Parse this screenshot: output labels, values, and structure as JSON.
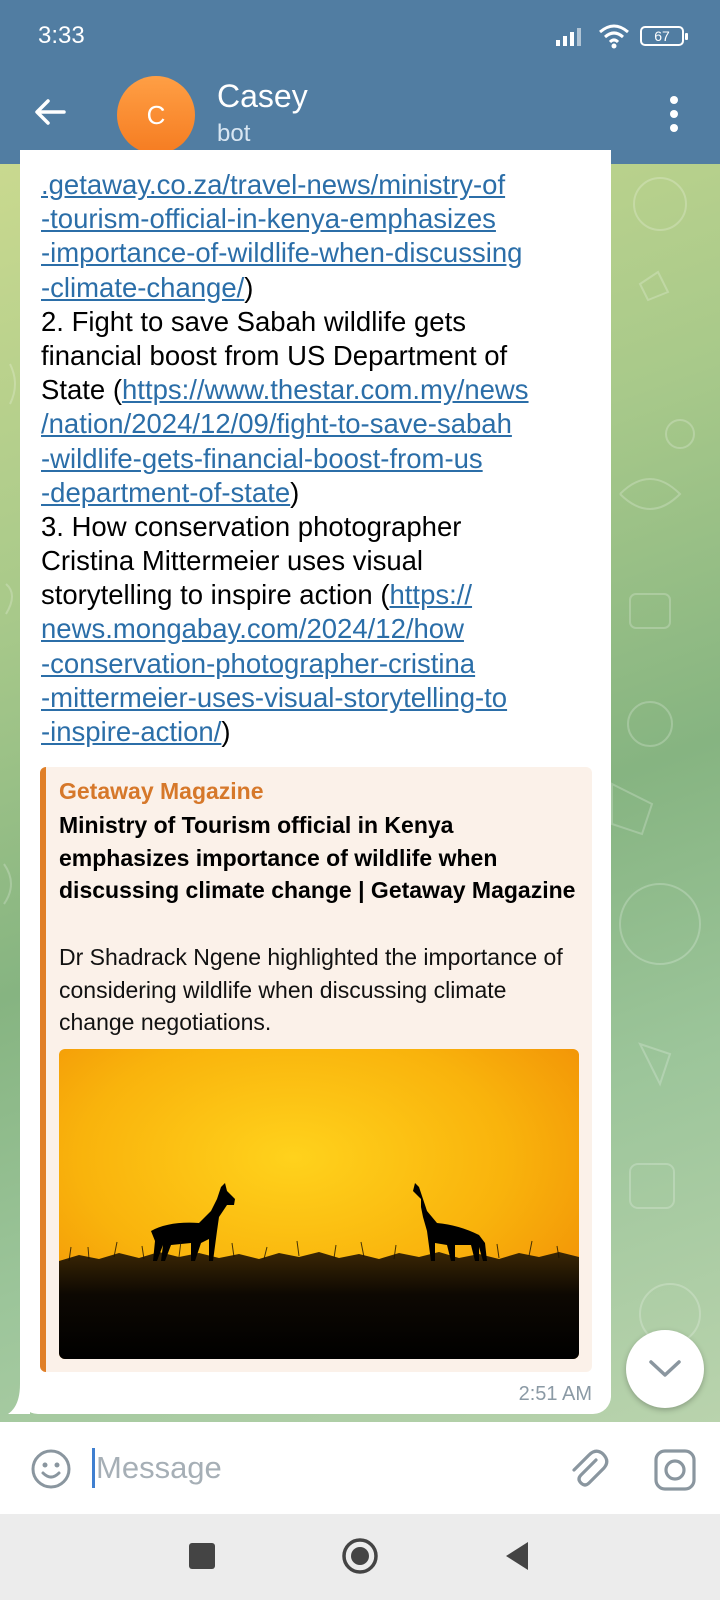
{
  "status_bar": {
    "time": "3:33",
    "battery": "67"
  },
  "header": {
    "avatar_letter": "C",
    "name": "Casey",
    "subtitle": "bot"
  },
  "message": {
    "lines": [
      [
        {
          "t": ".getaway.co.za/travel-news/ministry-of",
          "link": true
        }
      ],
      [
        {
          "t": "-tourism-official-in-kenya-emphasizes",
          "link": true
        }
      ],
      [
        {
          "t": "-importance-of-wildlife-when-discussing",
          "link": true
        }
      ],
      [
        {
          "t": "-climate-change/",
          "link": true
        },
        {
          "t": ")",
          "link": false
        }
      ],
      [
        {
          "t": "2. Fight to save Sabah wildlife gets",
          "link": false
        }
      ],
      [
        {
          "t": "financial boost from US Department of",
          "link": false
        }
      ],
      [
        {
          "t": "State (",
          "link": false
        },
        {
          "t": "https://www.thestar.com.my/news",
          "link": true
        }
      ],
      [
        {
          "t": "/nation/2024/12/09/fight-to-save-sabah",
          "link": true
        }
      ],
      [
        {
          "t": "-wildlife-gets-financial-boost-from-us",
          "link": true
        }
      ],
      [
        {
          "t": "-department-of-state",
          "link": true
        },
        {
          "t": ")",
          "link": false
        }
      ],
      [
        {
          "t": "3. How conservation photographer",
          "link": false
        }
      ],
      [
        {
          "t": "Cristina Mittermeier uses visual",
          "link": false
        }
      ],
      [
        {
          "t": "storytelling to inspire action (",
          "link": false
        },
        {
          "t": "https://",
          "link": true
        }
      ],
      [
        {
          "t": "news.mongabay.com/2024/12/how",
          "link": true
        }
      ],
      [
        {
          "t": "-conservation-photographer-cristina",
          "link": true
        }
      ],
      [
        {
          "t": "-mittermeier-uses-visual-storytelling-to",
          "link": true
        }
      ],
      [
        {
          "t": "-inspire-action/",
          "link": true
        },
        {
          "t": ")",
          "link": false
        }
      ]
    ],
    "time": "2:51 AM"
  },
  "link_preview": {
    "site": "Getaway Magazine",
    "title": "Ministry of Tourism official in Kenya emphasizes importance of wildlife when discussing climate change | Getaway Magazine",
    "description": "Dr Shadrack Ngene highlighted the importance of considering wildlife when discussing climate change negotiations."
  },
  "composer": {
    "placeholder": "Message"
  },
  "colors": {
    "header": "#517da2",
    "link": "#2b6ea8",
    "preview_accent": "#e07f27",
    "preview_site": "#d6782a"
  },
  "icons": {
    "back": "arrow-left-icon",
    "menu": "more-vertical-icon",
    "scroll": "chevron-down-icon",
    "emoji": "smiley-icon",
    "attach": "paperclip-icon",
    "camera": "camera-icon",
    "signal": "signal-icon",
    "wifi": "wifi-icon",
    "battery": "battery-icon"
  }
}
